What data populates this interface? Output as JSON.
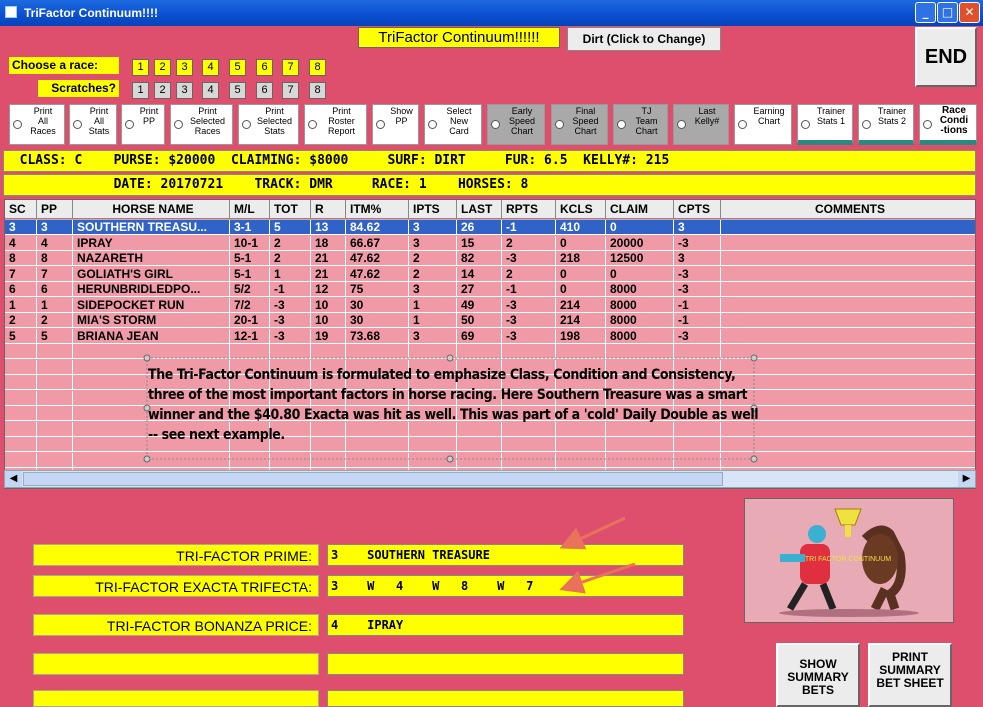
{
  "window": {
    "title": "TriFactor Continuum!!!!"
  },
  "header": {
    "app_title": "TriFactor Continuum!!!!!!",
    "dirt_button": "Dirt (Click to Change)",
    "end_button": "END"
  },
  "races": {
    "label": "Choose  a race:",
    "numbers": [
      "1",
      "2",
      "3",
      "4",
      "5",
      "6",
      "7",
      "8"
    ]
  },
  "scratches": {
    "label": "Scratches?",
    "numbers": [
      "1",
      "2",
      "3",
      "4",
      "5",
      "6",
      "7",
      "8"
    ]
  },
  "options": [
    {
      "label": "Print\nAll\nRaces"
    },
    {
      "label": "Print\nAll\nStats"
    },
    {
      "label": "Print\nPP"
    },
    {
      "label": "Print\nSelected\nRaces"
    },
    {
      "label": "Print\nSelected\nStats"
    },
    {
      "label": "Print\nRoster\nReport"
    },
    {
      "label": "Show\nPP"
    },
    {
      "label": "Select\nNew\nCard"
    },
    {
      "label": "Early\nSpeed\nChart"
    },
    {
      "label": "Final\nSpeed\nChart"
    },
    {
      "label": "TJ\nTeam\nChart"
    },
    {
      "label": "Last\nKelly#"
    },
    {
      "label": "Earning\nChart"
    },
    {
      "label": "Trainer\nStats 1"
    },
    {
      "label": "Trainer\nStats 2"
    },
    {
      "label": "Race\nCondi\n-tions"
    }
  ],
  "race_info": {
    "line1": "  CLASS: C    PURSE: $20000  CLAIMING: $8000     SURF: DIRT     FUR: 6.5  KELLY#: 215",
    "line2": "              DATE: 20170721    TRACK: DMR     RACE: 1    HORSES: 8"
  },
  "table": {
    "columns": [
      "SC",
      "PP",
      "HORSE NAME",
      "M/L",
      "TOT",
      "R",
      "ITM%",
      "IPTS",
      "LAST",
      "RPTS",
      "KCLS",
      "CLAIM",
      "CPTS",
      "COMMENTS"
    ],
    "rows": [
      [
        "3",
        "3",
        "SOUTHERN TREASU...",
        "3-1",
        "5",
        "13",
        "84.62",
        "3",
        "26",
        "-1",
        "410",
        "0",
        "3",
        ""
      ],
      [
        "4",
        "4",
        "IPRAY",
        "10-1",
        "2",
        "18",
        "66.67",
        "3",
        "15",
        "2",
        "0",
        "20000",
        "-3",
        ""
      ],
      [
        "8",
        "8",
        "NAZARETH",
        "5-1",
        "2",
        "21",
        "47.62",
        "2",
        "82",
        "-3",
        "218",
        "12500",
        "3",
        ""
      ],
      [
        "7",
        "7",
        "GOLIATH'S GIRL",
        "5-1",
        "1",
        "21",
        "47.62",
        "2",
        "14",
        "2",
        "0",
        "0",
        "-3",
        ""
      ],
      [
        "6",
        "6",
        "HERUNBRIDLEDPO...",
        "5/2",
        "-1",
        "12",
        "75",
        "3",
        "27",
        "-1",
        "0",
        "8000",
        "-3",
        ""
      ],
      [
        "1",
        "1",
        "SIDEPOCKET RUN",
        "7/2",
        "-3",
        "10",
        "30",
        "1",
        "49",
        "-3",
        "214",
        "8000",
        "-1",
        ""
      ],
      [
        "2",
        "2",
        "MIA'S STORM",
        "20-1",
        "-3",
        "10",
        "30",
        "1",
        "50",
        "-3",
        "214",
        "8000",
        "-1",
        ""
      ],
      [
        "5",
        "5",
        "BRIANA JEAN",
        "12-1",
        "-3",
        "19",
        "73.68",
        "3",
        "69",
        "-3",
        "198",
        "8000",
        "-3",
        ""
      ]
    ]
  },
  "annotation": {
    "text": "The Tri-Factor Continuum is formulated to emphasize Class, Condition and Consistency, three of the most important factors in horse racing.  Here Southern Treasure was a smart winner and the $40.80 Exacta was hit as well.  This was part of a 'cold' Daily Double as well -- see next example."
  },
  "results": {
    "prime_label": "TRI-FACTOR PRIME:",
    "prime_value": "3    SOUTHERN TREASURE",
    "exacta_label": "TRI-FACTOR EXACTA TRIFECTA:",
    "exacta_value": "3    W   4    W   8    W   7",
    "bonanza_label": "TRI-FACTOR BONANZA PRICE:",
    "bonanza_value": "4    IPRAY"
  },
  "logo": {
    "text": "TRI FACTOR CONTINUUM"
  },
  "buttons": {
    "show_summary": "SHOW SUMMARY BETS",
    "print_summary": "PRINT SUMMARY BET SHEET"
  },
  "colors": {
    "background": "#dd4f6c",
    "accent": "#ffff00",
    "selection": "#2f63c8",
    "arrow": "#e8735a"
  }
}
